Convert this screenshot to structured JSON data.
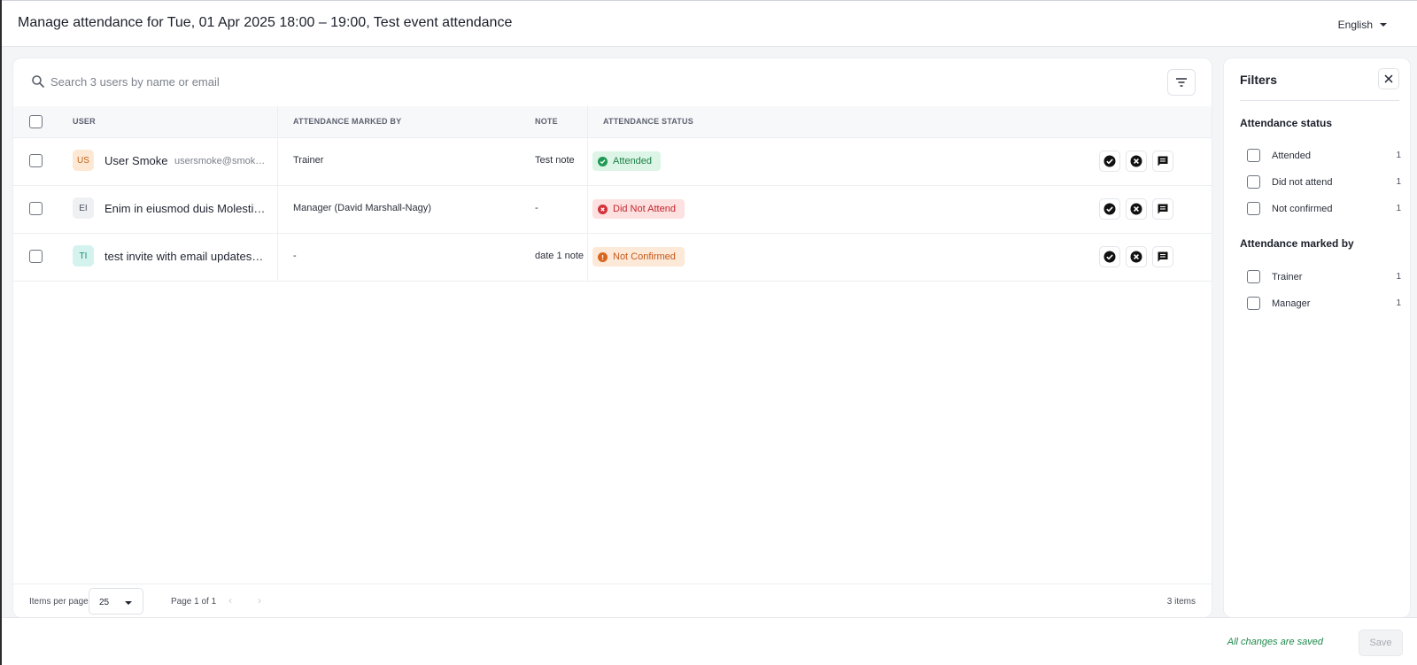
{
  "header": {
    "title": "Manage attendance for Tue, 01 Apr 2025 18:00 – 19:00, Test event attendance",
    "language": "English"
  },
  "search": {
    "placeholder": "Search 3 users by name or email",
    "value": ""
  },
  "table": {
    "columns": {
      "user": "USER",
      "marked_by": "ATTENDANCE MARKED BY",
      "note": "NOTE",
      "status": "ATTENDANCE STATUS"
    },
    "rows": [
      {
        "initials": "US",
        "avatar_bg": "#fde8d4",
        "avatar_fg": "#c0621a",
        "name": "User Smoke",
        "email": "usersmoke@smok…",
        "marked_by": "Trainer",
        "note": "Test note",
        "status": "Attended",
        "status_bg": "#dcf5e6",
        "status_fg": "#1b7f46",
        "status_icon": "check-circle-icon"
      },
      {
        "initials": "EI",
        "avatar_bg": "#eef0f3",
        "avatar_fg": "#4a4f5a",
        "name": "Enim in eiusmod duis Molesti…",
        "email": "",
        "marked_by": "Manager (David Marshall-Nagy)",
        "note": "-",
        "status": "Did Not Attend",
        "status_bg": "#fde1e1",
        "status_fg": "#c4242b",
        "status_icon": "x-circle-icon"
      },
      {
        "initials": "TI",
        "avatar_bg": "#d4f3ee",
        "avatar_fg": "#1a8a78",
        "name": "test invite with email updates…",
        "email": "",
        "marked_by": "-",
        "note": "date 1 note",
        "status": "Not Confirmed",
        "status_bg": "#fde9d8",
        "status_fg": "#c4581a",
        "status_icon": "exclamation-circle-icon"
      }
    ]
  },
  "pagination": {
    "items_per_page_label": "Items per page",
    "items_per_page": "25",
    "page_info": "Page 1 of 1",
    "total": "3 items"
  },
  "filters": {
    "title": "Filters",
    "status_section": "Attendance status",
    "status_options": [
      {
        "label": "Attended",
        "count": "1"
      },
      {
        "label": "Did not attend",
        "count": "1"
      },
      {
        "label": "Not confirmed",
        "count": "1"
      }
    ],
    "marked_by_section": "Attendance marked by",
    "marked_by_options": [
      {
        "label": "Trainer",
        "count": "1"
      },
      {
        "label": "Manager",
        "count": "1"
      }
    ]
  },
  "footer": {
    "saved_text": "All changes are saved",
    "save_label": "Save"
  }
}
